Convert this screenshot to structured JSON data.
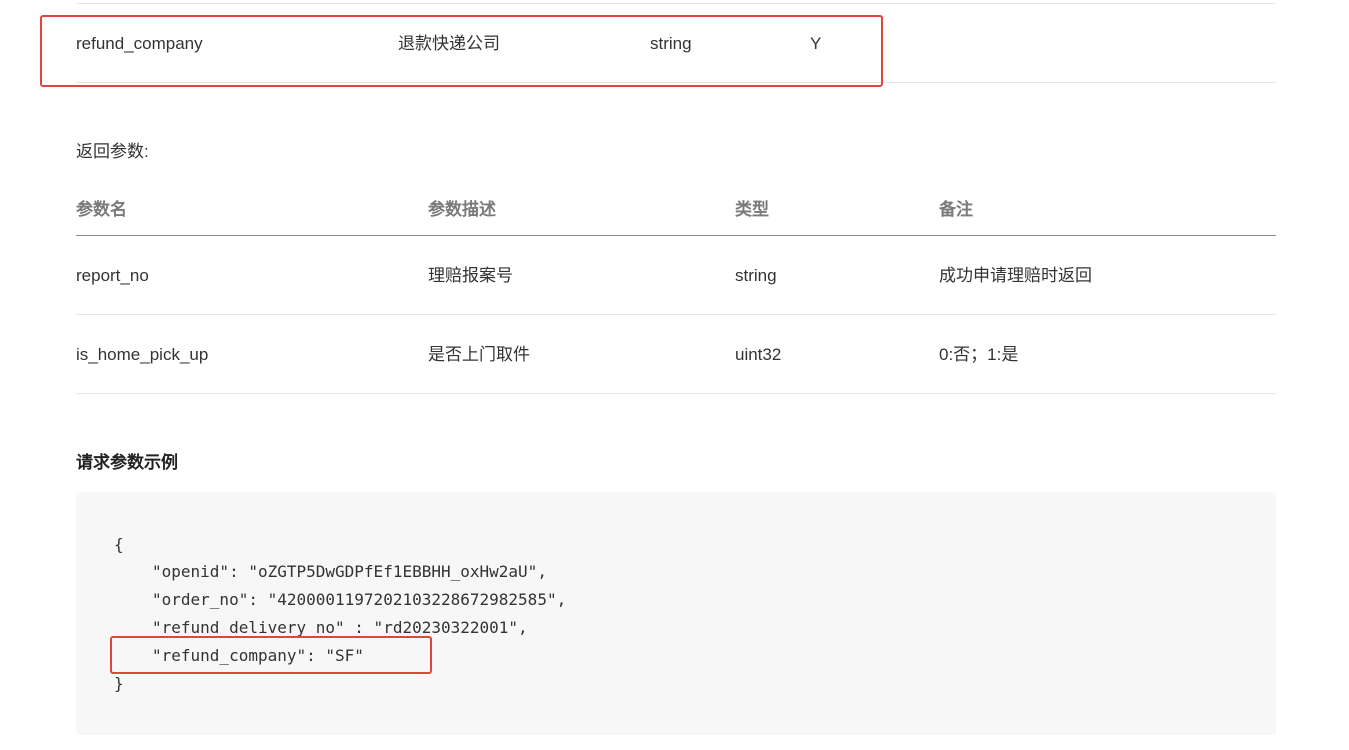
{
  "top_row": {
    "name": "refund_company",
    "description": "退款快递公司",
    "type": "string",
    "required": "Y"
  },
  "return_params": {
    "label": "返回参数:",
    "headers": {
      "name": "参数名",
      "description": "参数描述",
      "type": "类型",
      "note": "备注"
    },
    "rows": [
      {
        "name": "report_no",
        "description": "理赔报案号",
        "type": "string",
        "note": "成功申请理赔时返回"
      },
      {
        "name": "is_home_pick_up",
        "description": "是否上门取件",
        "type": "uint32",
        "note": "0:否；1:是"
      }
    ]
  },
  "request_example": {
    "heading": "请求参数示例",
    "lines": {
      "open_brace": "{",
      "openid": "\"openid\": \"oZGTP5DwGDPfEf1EBBHH_oxHw2aU\",",
      "order_no": "\"order_no\": \"4200001197202103228672982585\",",
      "refund_delivery_no": "\"refund_delivery_no\" : \"rd20230322001\",",
      "refund_company": "\"refund_company\": \"SF\"",
      "close_brace": "}"
    }
  },
  "colors": {
    "highlight": "#e0463c",
    "code_background": "#f7f7f7",
    "header_text": "#7a7a7a"
  }
}
